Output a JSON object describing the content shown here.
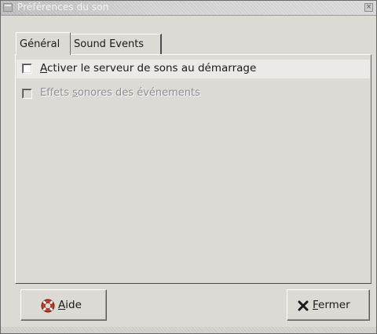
{
  "window": {
    "title": "Préférences du son",
    "close_glyph": "×"
  },
  "tabs": [
    {
      "label": "Général",
      "active": true
    },
    {
      "label": "Sound Events",
      "active": false
    }
  ],
  "options": [
    {
      "mnemonic": "A",
      "label_rest": "ctiver le serveur de sons au démarrage",
      "checked": false,
      "enabled": true
    },
    {
      "label_before": "Effets ",
      "mnemonic": "s",
      "label_rest": "onores des événements",
      "checked": false,
      "enabled": false
    }
  ],
  "buttons": {
    "help": {
      "mnemonic": "A",
      "rest": "ide",
      "icon": "lifebuoy-icon"
    },
    "close": {
      "mnemonic": "F",
      "rest": "ermer",
      "icon": "x-close-icon"
    }
  },
  "colors": {
    "window_bg": "#dcdad5",
    "highlight_row": "#eceae6",
    "lifebuoy_red": "#d63a1f"
  }
}
